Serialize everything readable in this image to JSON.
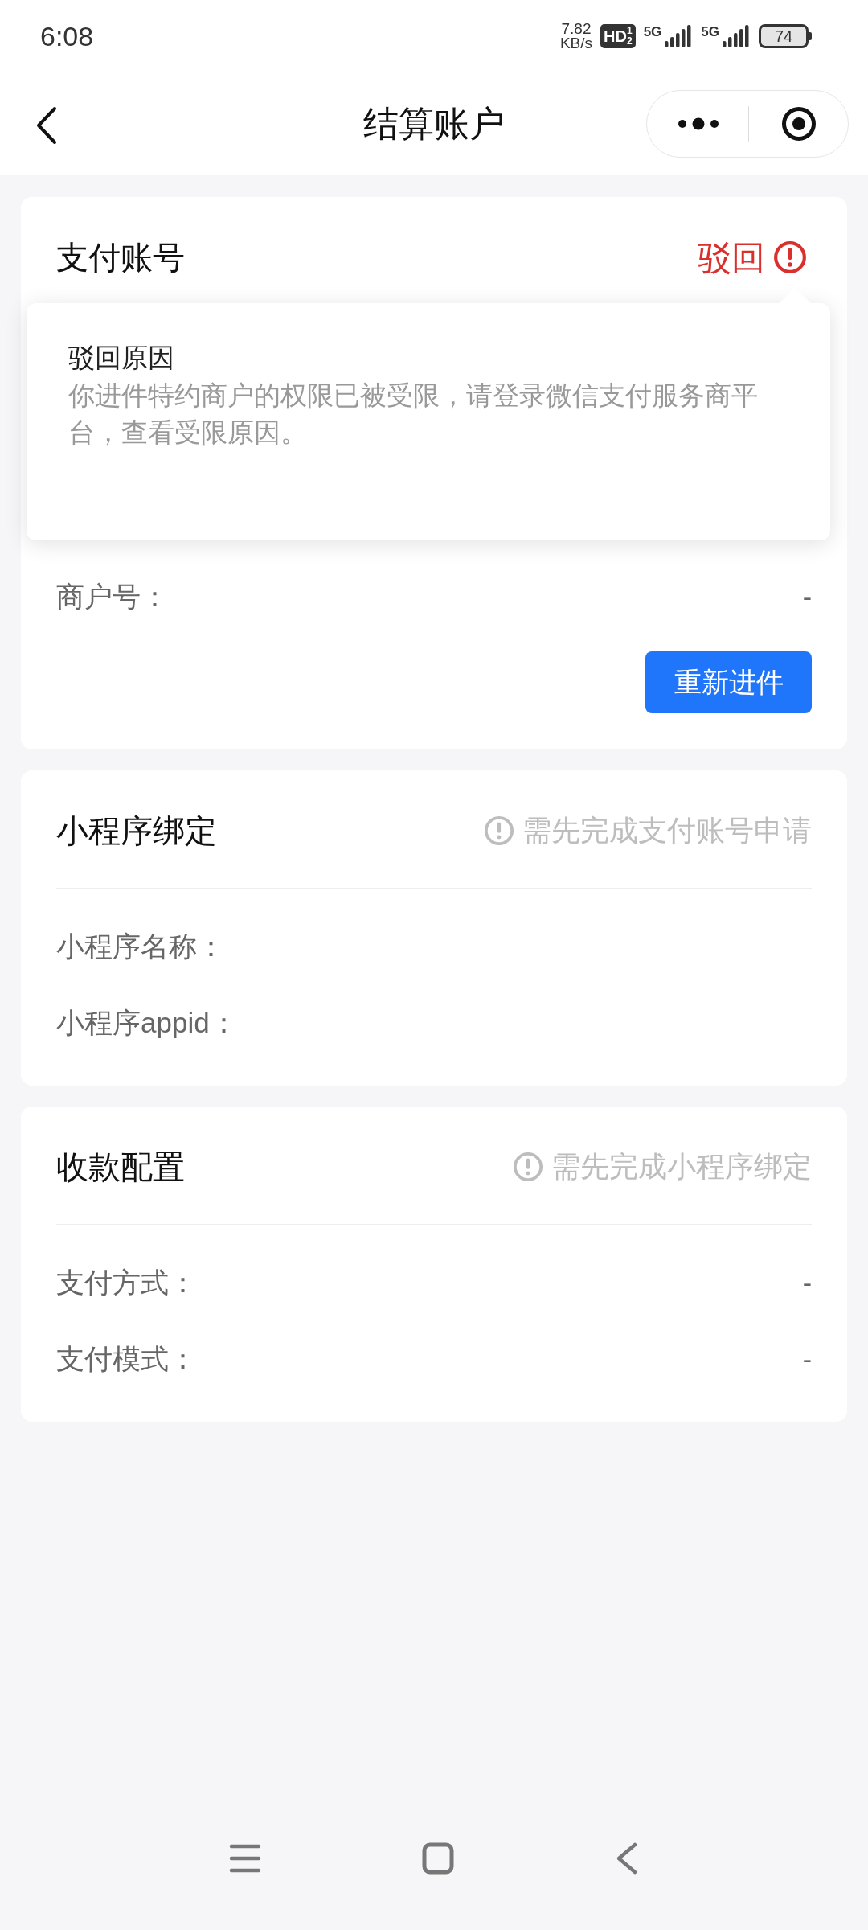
{
  "status_bar": {
    "time": "6:08",
    "net_speed": [
      "7.82",
      "KB/s"
    ],
    "hd": {
      "text": "HD",
      "sup": "1",
      "sub": "2"
    },
    "signals": [
      "5G",
      "5G"
    ],
    "battery": "74"
  },
  "header": {
    "title": "结算账户"
  },
  "cards": [
    {
      "title": "支付账号",
      "status": {
        "kind": "rejected",
        "text": "驳回"
      },
      "divider": false,
      "popup": {
        "title": "驳回原因",
        "message": "你进件特约商户的权限已被受限，请登录微信支付服务商平台，查看受限原因。"
      },
      "rows": [
        {
          "label": "商户号：",
          "value": "-"
        }
      ],
      "button": "重新进件"
    },
    {
      "title": "小程序绑定",
      "status": {
        "kind": "locked",
        "text": "需先完成支付账号申请"
      },
      "divider": true,
      "rows": [
        {
          "label": "小程序名称："
        },
        {
          "label": "小程序appid："
        }
      ]
    },
    {
      "title": "收款配置",
      "status": {
        "kind": "locked",
        "text": "需先完成小程序绑定"
      },
      "divider": true,
      "rows": [
        {
          "label": "支付方式：",
          "value": "-"
        },
        {
          "label": "支付模式：",
          "value": "-"
        }
      ]
    }
  ]
}
